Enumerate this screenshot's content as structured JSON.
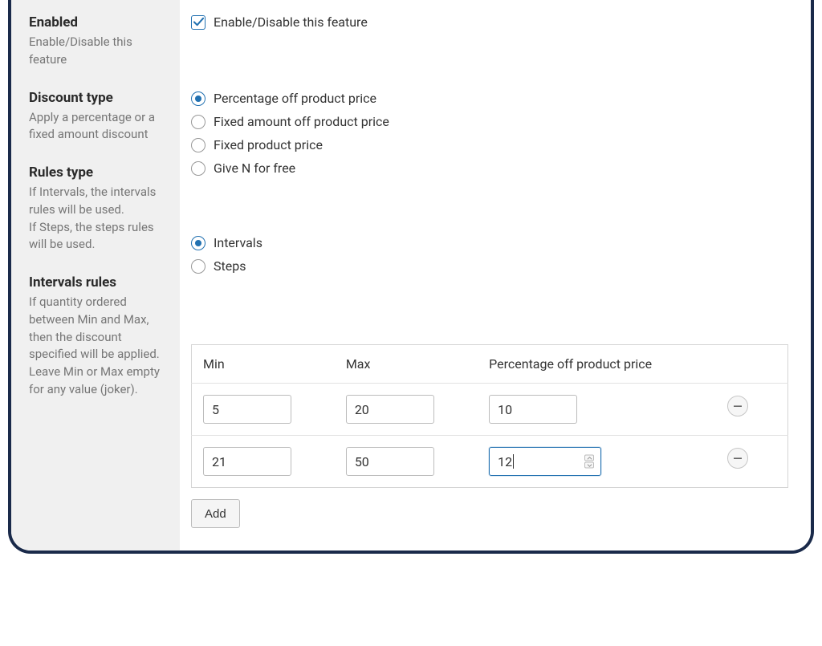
{
  "sections": {
    "enabled": {
      "title": "Enabled",
      "desc": "Enable/Disable this feature",
      "checkbox_label": "Enable/Disable this feature",
      "checked": true
    },
    "discount_type": {
      "title": "Discount type",
      "desc": "Apply a percentage or a fixed amount discount",
      "options": [
        {
          "label": "Percentage off product price",
          "selected": true
        },
        {
          "label": "Fixed amount off product price",
          "selected": false
        },
        {
          "label": "Fixed product price",
          "selected": false
        },
        {
          "label": "Give N for free",
          "selected": false
        }
      ]
    },
    "rules_type": {
      "title": "Rules type",
      "desc": "If Intervals, the intervals rules will be used.\nIf Steps, the steps rules will be used.",
      "options": [
        {
          "label": "Intervals",
          "selected": true
        },
        {
          "label": "Steps",
          "selected": false
        }
      ]
    },
    "intervals_rules": {
      "title": "Intervals rules",
      "desc": "If quantity ordered between Min and Max, then the discount specified will be applied.\nLeave Min or Max empty for any value (joker).",
      "headers": {
        "min": "Min",
        "max": "Max",
        "value": "Percentage off product price"
      },
      "rows": [
        {
          "min": "5",
          "max": "20",
          "value": "10",
          "focused": false
        },
        {
          "min": "21",
          "max": "50",
          "value": "12",
          "focused": true
        }
      ],
      "add_label": "Add"
    }
  }
}
